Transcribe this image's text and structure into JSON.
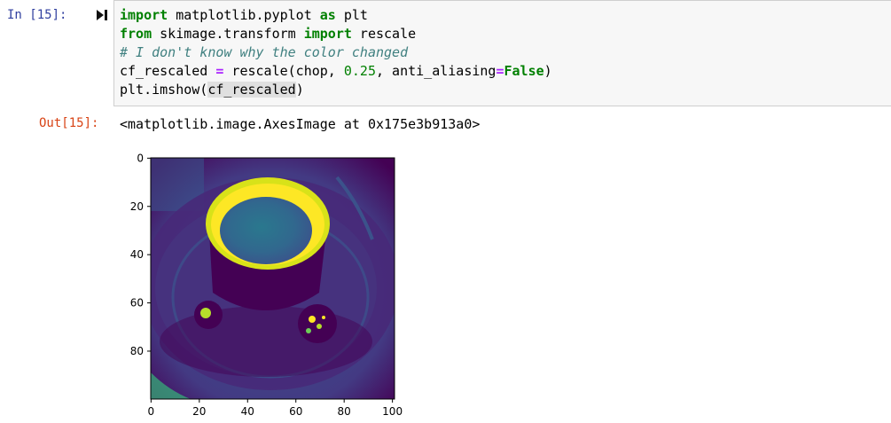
{
  "cell": {
    "in_prompt": "In [15]:",
    "out_prompt": "Out[15]:",
    "code_lines": [
      [
        {
          "t": "import",
          "c": "kw"
        },
        {
          "t": " matplotlib.pyplot ",
          "c": ""
        },
        {
          "t": "as",
          "c": "kw"
        },
        {
          "t": " plt",
          "c": ""
        }
      ],
      [
        {
          "t": "from",
          "c": "kw"
        },
        {
          "t": " skimage.transform ",
          "c": ""
        },
        {
          "t": "import",
          "c": "kw"
        },
        {
          "t": " rescale",
          "c": ""
        }
      ],
      [
        {
          "t": "# I don't know why the color changed",
          "c": "cm"
        }
      ],
      [
        {
          "t": "cf_rescaled ",
          "c": ""
        },
        {
          "t": "=",
          "c": "op"
        },
        {
          "t": " rescale(chop, ",
          "c": ""
        },
        {
          "t": "0.25",
          "c": "num"
        },
        {
          "t": ", anti_aliasing",
          "c": ""
        },
        {
          "t": "=",
          "c": "op"
        },
        {
          "t": "False",
          "c": "kw"
        },
        {
          "t": ")",
          "c": ""
        }
      ],
      [
        {
          "t": "plt.imshow(",
          "c": ""
        },
        {
          "t": "cf_rescaled",
          "c": "hl"
        },
        {
          "t": ")",
          "c": ""
        }
      ]
    ],
    "output_text": "<matplotlib.image.AxesImage at 0x175e3b913a0>"
  },
  "colors": {
    "in_prompt": "#303F9F",
    "out_prompt": "#D84315",
    "keyword": "#008000",
    "comment": "#408080",
    "viridis_dark": "#440154",
    "viridis_mid": "#21918c",
    "viridis_yellow": "#fde725"
  },
  "icons": {
    "run": "run-cell-icon"
  },
  "plot": {
    "x_ticks": [
      "0",
      "20",
      "40",
      "60",
      "80",
      "100"
    ],
    "y_ticks": [
      "0",
      "20",
      "40",
      "60",
      "80"
    ],
    "image_description_cmap": "viridis"
  }
}
